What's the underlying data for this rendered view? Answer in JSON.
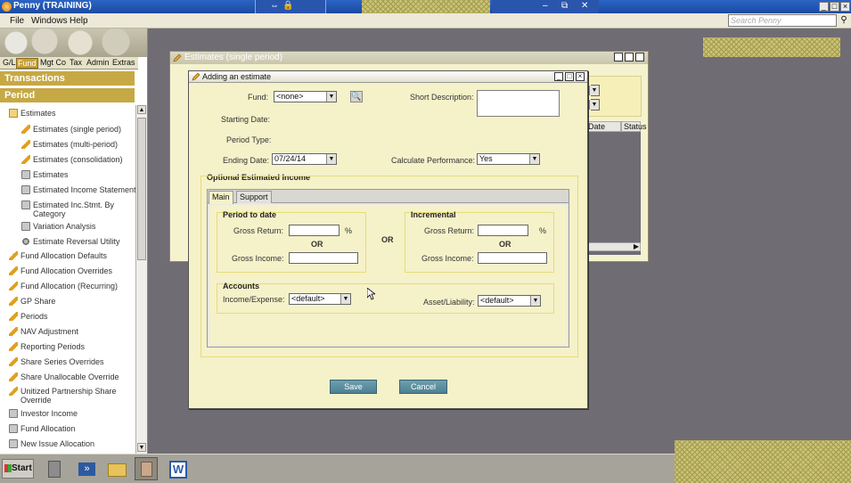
{
  "window": {
    "title": "Penny (TRAINING)"
  },
  "menu": [
    "File",
    "Windows",
    "Help"
  ],
  "search": {
    "placeholder": "Search Penny"
  },
  "nav_tabs": [
    "G/L",
    "Fund",
    "Mgt Co",
    "Tax",
    "Admin",
    "Extras"
  ],
  "nav_active_tab": "Fund",
  "sections": {
    "transactions": "Transactions",
    "period": "Period"
  },
  "nav_items": [
    {
      "label": "Estimates",
      "icon": "folder-icon",
      "indent": 0
    },
    {
      "label": "Estimates (single period)",
      "icon": "pencil-icon",
      "indent": 1
    },
    {
      "label": "Estimates (multi-period)",
      "icon": "pencil-icon",
      "indent": 1
    },
    {
      "label": "Estimates (consolidation)",
      "icon": "pencil-icon",
      "indent": 1
    },
    {
      "label": "Estimates",
      "icon": "printer-icon",
      "indent": 1
    },
    {
      "label": "Estimated Income Statement",
      "icon": "printer-icon",
      "indent": 1
    },
    {
      "label": "Estimated Inc.Stmt. By Category",
      "icon": "printer-icon",
      "indent": 1
    },
    {
      "label": "Variation Analysis",
      "icon": "printer-icon",
      "indent": 1
    },
    {
      "label": "Estimate Reversal Utility",
      "icon": "gear-icon",
      "indent": 1
    },
    {
      "label": "Fund Allocation Defaults",
      "icon": "pencil-icon",
      "indent": 0
    },
    {
      "label": "Fund Allocation Overrides",
      "icon": "pencil-icon",
      "indent": 0
    },
    {
      "label": "Fund Allocation (Recurring)",
      "icon": "pencil-icon",
      "indent": 0
    },
    {
      "label": "GP Share",
      "icon": "pencil-icon",
      "indent": 0
    },
    {
      "label": "Periods",
      "icon": "pencil-icon",
      "indent": 0
    },
    {
      "label": "NAV Adjustment",
      "icon": "pencil-icon",
      "indent": 0
    },
    {
      "label": "Reporting Periods",
      "icon": "pencil-icon",
      "indent": 0
    },
    {
      "label": "Share Series Overrides",
      "icon": "pencil-icon",
      "indent": 0
    },
    {
      "label": "Share Unallocable Override",
      "icon": "pencil-icon",
      "indent": 0
    },
    {
      "label": "Unitized Partnership Share Override",
      "icon": "pencil-icon",
      "indent": 0
    },
    {
      "label": "Investor Income",
      "icon": "printer-icon",
      "indent": 0
    },
    {
      "label": "Fund Allocation",
      "icon": "printer-icon",
      "indent": 0
    },
    {
      "label": "New Issue Allocation",
      "icon": "printer-icon",
      "indent": 0
    }
  ],
  "bg_window": {
    "title": "Estimates (single period)",
    "col_date": "Date",
    "col_status": "Status"
  },
  "dialog": {
    "title": "Adding an estimate",
    "fund_label": "Fund:",
    "fund_value": "<none>",
    "short_desc_label": "Short Description:",
    "starting_date_label": "Starting Date:",
    "period_type_label": "Period Type:",
    "ending_date_label": "Ending Date:",
    "ending_date_value": "07/24/14",
    "calc_perf_label": "Calculate Performance:",
    "calc_perf_value": "Yes",
    "optional_title": "Optional Estimated Income",
    "tabs": [
      "Main",
      "Support"
    ],
    "ptd": {
      "title": "Period to date",
      "gross_return_label": "Gross Return:",
      "percent": "%",
      "or": "OR",
      "gross_income_label": "Gross Income:"
    },
    "middle_or": "OR",
    "inc": {
      "title": "Incremental",
      "gross_return_label": "Gross Return:",
      "percent": "%",
      "or": "OR",
      "gross_income_label": "Gross Income:"
    },
    "accounts": {
      "title": "Accounts",
      "income_expense_label": "Income/Expense:",
      "income_expense_value": "<default>",
      "asset_liability_label": "Asset/Liability:",
      "asset_liability_value": "<default>"
    },
    "save_label": "Save",
    "cancel_label": "Cancel"
  },
  "taskbar": {
    "start_label": "Start"
  }
}
